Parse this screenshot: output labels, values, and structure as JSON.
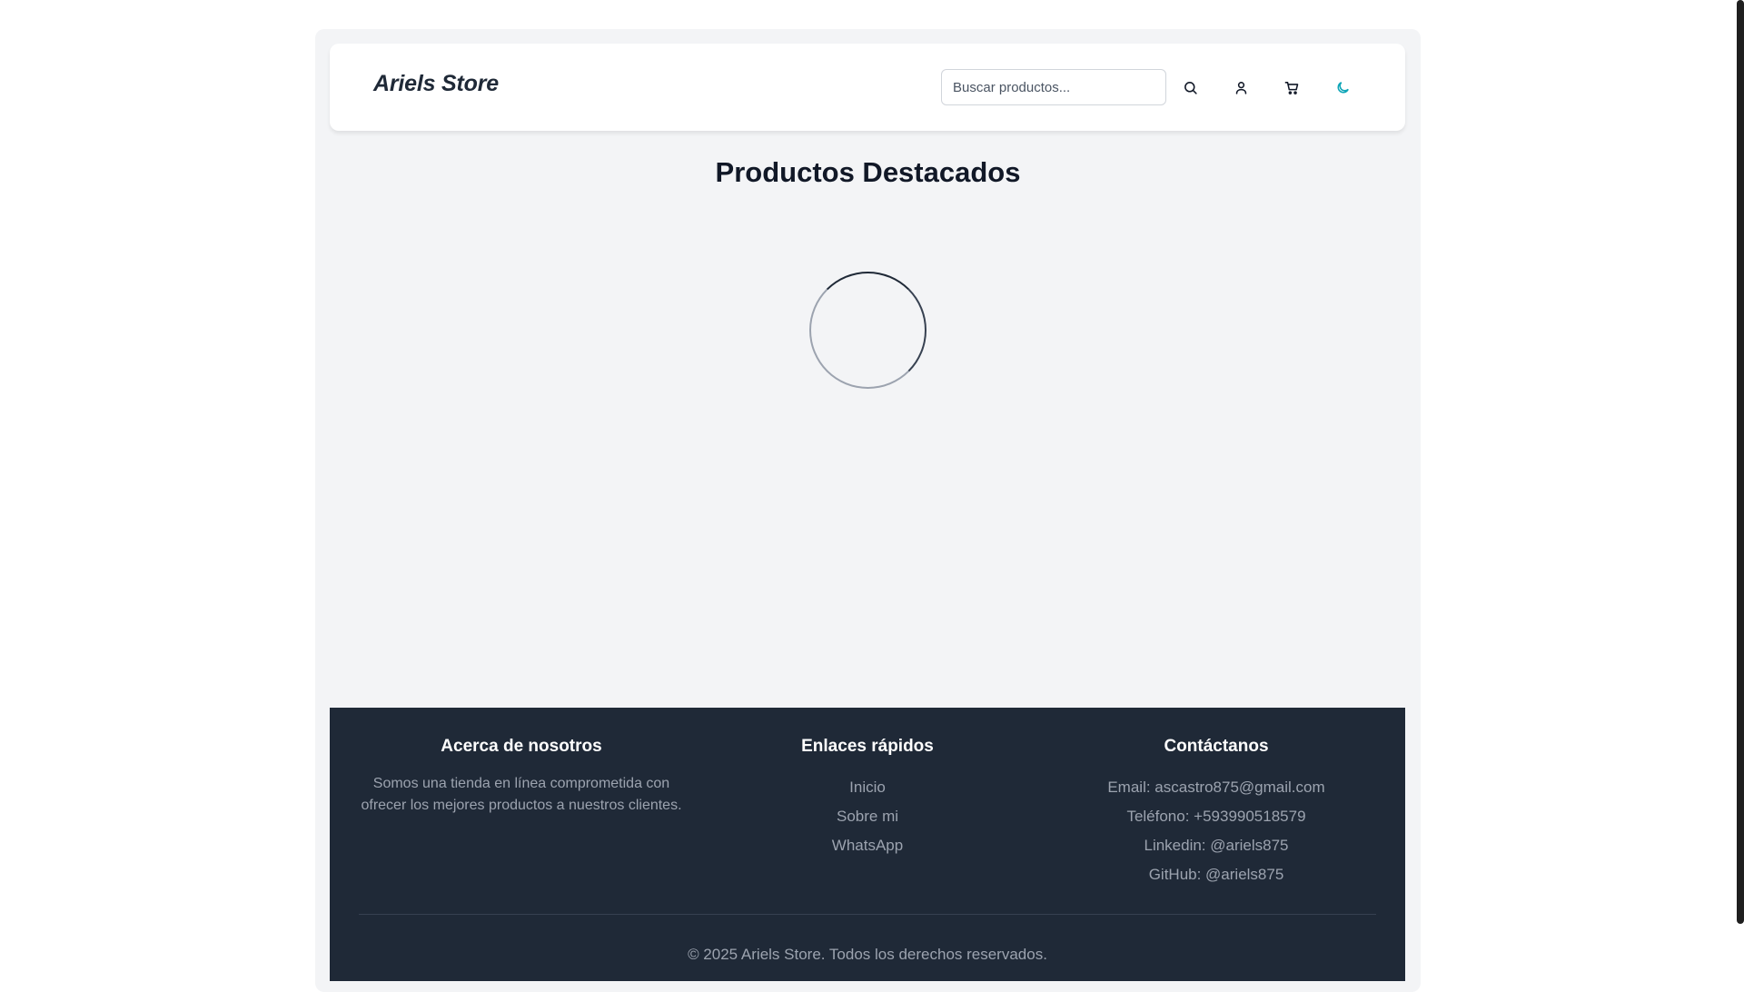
{
  "header": {
    "logo": "Ariels Store",
    "search_placeholder": "Buscar productos...",
    "icons": [
      "search-icon",
      "user-icon",
      "cart-icon",
      "moon-icon"
    ],
    "accent_color": "#0ea5b7"
  },
  "main": {
    "title": "Productos Destacados",
    "loading": true
  },
  "footer": {
    "about": {
      "heading": "Acerca de nosotros",
      "text": "Somos una tienda en línea comprometida con ofrecer los mejores productos a nuestros clientes."
    },
    "links": {
      "heading": "Enlaces rápidos",
      "items": [
        "Inicio",
        "Sobre mi",
        "WhatsApp"
      ]
    },
    "contact": {
      "heading": "Contáctanos",
      "items": [
        "Email: ascastro875@gmail.com",
        "Teléfono: +593990518579",
        "Linkedin: @ariels875",
        "GitHub: @ariels875"
      ]
    },
    "copyright": "© 2025 Ariels Store. Todos los derechos reservados.",
    "background": "#1f2937"
  }
}
